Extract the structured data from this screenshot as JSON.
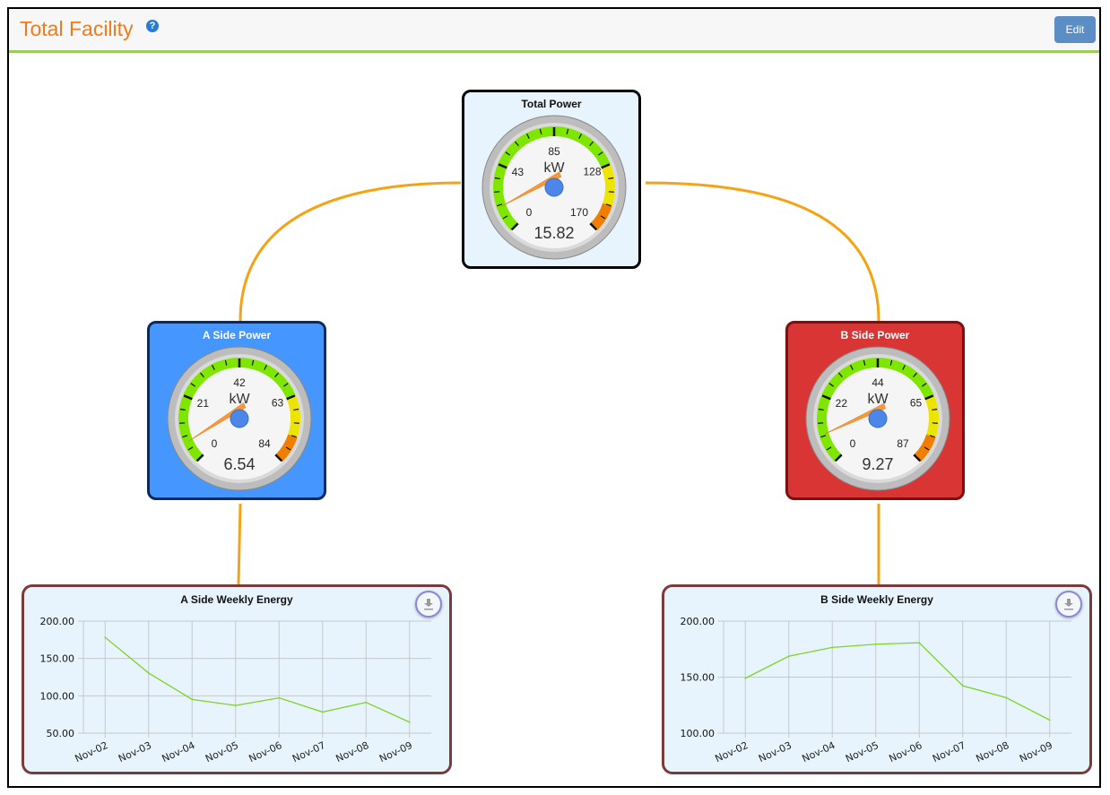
{
  "header": {
    "title": "Total Facility",
    "help_icon": "question-circle-icon",
    "edit_label": "Edit"
  },
  "colors": {
    "title": "#f07b1d",
    "header_rule": "#9ccc5a",
    "link_line": "#f5a314",
    "a_side": "#4596ff",
    "b_side": "#d93535",
    "total": "#e8f4fd",
    "series": "#7ed321"
  },
  "gauges": {
    "total": {
      "title": "Total Power",
      "unit": "kW",
      "value": "15.82",
      "reading": 15.82,
      "max": 170,
      "labels": [
        "0",
        "43",
        "85",
        "128",
        "170"
      ]
    },
    "a_side": {
      "title": "A Side Power",
      "unit": "kW",
      "value": "6.54",
      "reading": 6.54,
      "max": 84,
      "labels": [
        "0",
        "21",
        "42",
        "63",
        "84"
      ]
    },
    "b_side": {
      "title": "B Side Power",
      "unit": "kW",
      "value": "9.27",
      "reading": 9.27,
      "max": 87,
      "labels": [
        "0",
        "22",
        "44",
        "65",
        "87"
      ]
    }
  },
  "chart_data": [
    {
      "type": "line",
      "title": "A Side Weekly Energy",
      "categories": [
        "Nov-02",
        "Nov-03",
        "Nov-04",
        "Nov-05",
        "Nov-06",
        "Nov-07",
        "Nov-08",
        "Nov-09"
      ],
      "series": [
        {
          "name": "A Side",
          "values": [
            178.3,
            130.5,
            95.2,
            87.1,
            97.2,
            78.3,
            91.2,
            64.7
          ]
        }
      ],
      "yticks": [
        "50.00",
        "100.00",
        "150.00",
        "200.00"
      ],
      "ylim": [
        50,
        200
      ],
      "xlabel": "",
      "ylabel": "",
      "grid": true,
      "download_icon": "download-icon"
    },
    {
      "type": "line",
      "title": "B Side Weekly Energy",
      "categories": [
        "Nov-02",
        "Nov-03",
        "Nov-04",
        "Nov-05",
        "Nov-06",
        "Nov-07",
        "Nov-08",
        "Nov-09"
      ],
      "series": [
        {
          "name": "B Side",
          "values": [
            149.0,
            168.7,
            176.5,
            179.4,
            180.7,
            142.3,
            131.7,
            111.7
          ]
        }
      ],
      "yticks": [
        "100.00",
        "150.00",
        "200.00"
      ],
      "ylim": [
        100,
        200
      ],
      "xlabel": "",
      "ylabel": "",
      "grid": true,
      "download_icon": "download-icon"
    }
  ]
}
